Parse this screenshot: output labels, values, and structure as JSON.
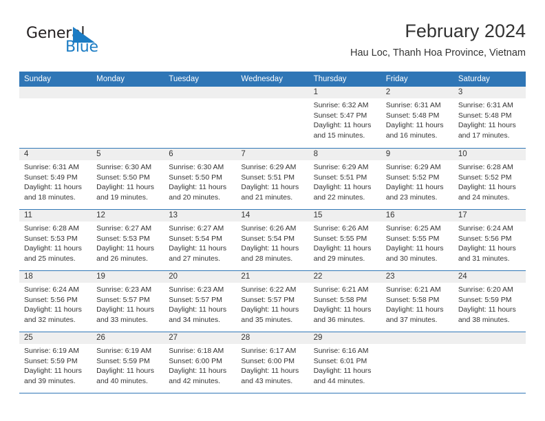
{
  "logo": {
    "text_primary": "General",
    "text_secondary": "Blue",
    "triangle_color": "#1c7cc4"
  },
  "header": {
    "title": "February 2024",
    "location": "Hau Loc, Thanh Hoa Province, Vietnam"
  },
  "theme": {
    "header_blue": "#2f76b6",
    "date_band_gray": "#efefef",
    "text_dark": "#333333",
    "logo_blue": "#1c7cc4"
  },
  "calendar": {
    "day_names": [
      "Sunday",
      "Monday",
      "Tuesday",
      "Wednesday",
      "Thursday",
      "Friday",
      "Saturday"
    ],
    "weeks": [
      [
        {
          "day": "",
          "lines": []
        },
        {
          "day": "",
          "lines": []
        },
        {
          "day": "",
          "lines": []
        },
        {
          "day": "",
          "lines": []
        },
        {
          "day": "1",
          "lines": [
            "Sunrise: 6:32 AM",
            "Sunset: 5:47 PM",
            "Daylight: 11 hours",
            "and 15 minutes."
          ]
        },
        {
          "day": "2",
          "lines": [
            "Sunrise: 6:31 AM",
            "Sunset: 5:48 PM",
            "Daylight: 11 hours",
            "and 16 minutes."
          ]
        },
        {
          "day": "3",
          "lines": [
            "Sunrise: 6:31 AM",
            "Sunset: 5:48 PM",
            "Daylight: 11 hours",
            "and 17 minutes."
          ]
        }
      ],
      [
        {
          "day": "4",
          "lines": [
            "Sunrise: 6:31 AM",
            "Sunset: 5:49 PM",
            "Daylight: 11 hours",
            "and 18 minutes."
          ]
        },
        {
          "day": "5",
          "lines": [
            "Sunrise: 6:30 AM",
            "Sunset: 5:50 PM",
            "Daylight: 11 hours",
            "and 19 minutes."
          ]
        },
        {
          "day": "6",
          "lines": [
            "Sunrise: 6:30 AM",
            "Sunset: 5:50 PM",
            "Daylight: 11 hours",
            "and 20 minutes."
          ]
        },
        {
          "day": "7",
          "lines": [
            "Sunrise: 6:29 AM",
            "Sunset: 5:51 PM",
            "Daylight: 11 hours",
            "and 21 minutes."
          ]
        },
        {
          "day": "8",
          "lines": [
            "Sunrise: 6:29 AM",
            "Sunset: 5:51 PM",
            "Daylight: 11 hours",
            "and 22 minutes."
          ]
        },
        {
          "day": "9",
          "lines": [
            "Sunrise: 6:29 AM",
            "Sunset: 5:52 PM",
            "Daylight: 11 hours",
            "and 23 minutes."
          ]
        },
        {
          "day": "10",
          "lines": [
            "Sunrise: 6:28 AM",
            "Sunset: 5:52 PM",
            "Daylight: 11 hours",
            "and 24 minutes."
          ]
        }
      ],
      [
        {
          "day": "11",
          "lines": [
            "Sunrise: 6:28 AM",
            "Sunset: 5:53 PM",
            "Daylight: 11 hours",
            "and 25 minutes."
          ]
        },
        {
          "day": "12",
          "lines": [
            "Sunrise: 6:27 AM",
            "Sunset: 5:53 PM",
            "Daylight: 11 hours",
            "and 26 minutes."
          ]
        },
        {
          "day": "13",
          "lines": [
            "Sunrise: 6:27 AM",
            "Sunset: 5:54 PM",
            "Daylight: 11 hours",
            "and 27 minutes."
          ]
        },
        {
          "day": "14",
          "lines": [
            "Sunrise: 6:26 AM",
            "Sunset: 5:54 PM",
            "Daylight: 11 hours",
            "and 28 minutes."
          ]
        },
        {
          "day": "15",
          "lines": [
            "Sunrise: 6:26 AM",
            "Sunset: 5:55 PM",
            "Daylight: 11 hours",
            "and 29 minutes."
          ]
        },
        {
          "day": "16",
          "lines": [
            "Sunrise: 6:25 AM",
            "Sunset: 5:55 PM",
            "Daylight: 11 hours",
            "and 30 minutes."
          ]
        },
        {
          "day": "17",
          "lines": [
            "Sunrise: 6:24 AM",
            "Sunset: 5:56 PM",
            "Daylight: 11 hours",
            "and 31 minutes."
          ]
        }
      ],
      [
        {
          "day": "18",
          "lines": [
            "Sunrise: 6:24 AM",
            "Sunset: 5:56 PM",
            "Daylight: 11 hours",
            "and 32 minutes."
          ]
        },
        {
          "day": "19",
          "lines": [
            "Sunrise: 6:23 AM",
            "Sunset: 5:57 PM",
            "Daylight: 11 hours",
            "and 33 minutes."
          ]
        },
        {
          "day": "20",
          "lines": [
            "Sunrise: 6:23 AM",
            "Sunset: 5:57 PM",
            "Daylight: 11 hours",
            "and 34 minutes."
          ]
        },
        {
          "day": "21",
          "lines": [
            "Sunrise: 6:22 AM",
            "Sunset: 5:57 PM",
            "Daylight: 11 hours",
            "and 35 minutes."
          ]
        },
        {
          "day": "22",
          "lines": [
            "Sunrise: 6:21 AM",
            "Sunset: 5:58 PM",
            "Daylight: 11 hours",
            "and 36 minutes."
          ]
        },
        {
          "day": "23",
          "lines": [
            "Sunrise: 6:21 AM",
            "Sunset: 5:58 PM",
            "Daylight: 11 hours",
            "and 37 minutes."
          ]
        },
        {
          "day": "24",
          "lines": [
            "Sunrise: 6:20 AM",
            "Sunset: 5:59 PM",
            "Daylight: 11 hours",
            "and 38 minutes."
          ]
        }
      ],
      [
        {
          "day": "25",
          "lines": [
            "Sunrise: 6:19 AM",
            "Sunset: 5:59 PM",
            "Daylight: 11 hours",
            "and 39 minutes."
          ]
        },
        {
          "day": "26",
          "lines": [
            "Sunrise: 6:19 AM",
            "Sunset: 5:59 PM",
            "Daylight: 11 hours",
            "and 40 minutes."
          ]
        },
        {
          "day": "27",
          "lines": [
            "Sunrise: 6:18 AM",
            "Sunset: 6:00 PM",
            "Daylight: 11 hours",
            "and 42 minutes."
          ]
        },
        {
          "day": "28",
          "lines": [
            "Sunrise: 6:17 AM",
            "Sunset: 6:00 PM",
            "Daylight: 11 hours",
            "and 43 minutes."
          ]
        },
        {
          "day": "29",
          "lines": [
            "Sunrise: 6:16 AM",
            "Sunset: 6:01 PM",
            "Daylight: 11 hours",
            "and 44 minutes."
          ]
        },
        {
          "day": "",
          "lines": []
        },
        {
          "day": "",
          "lines": []
        }
      ]
    ]
  }
}
